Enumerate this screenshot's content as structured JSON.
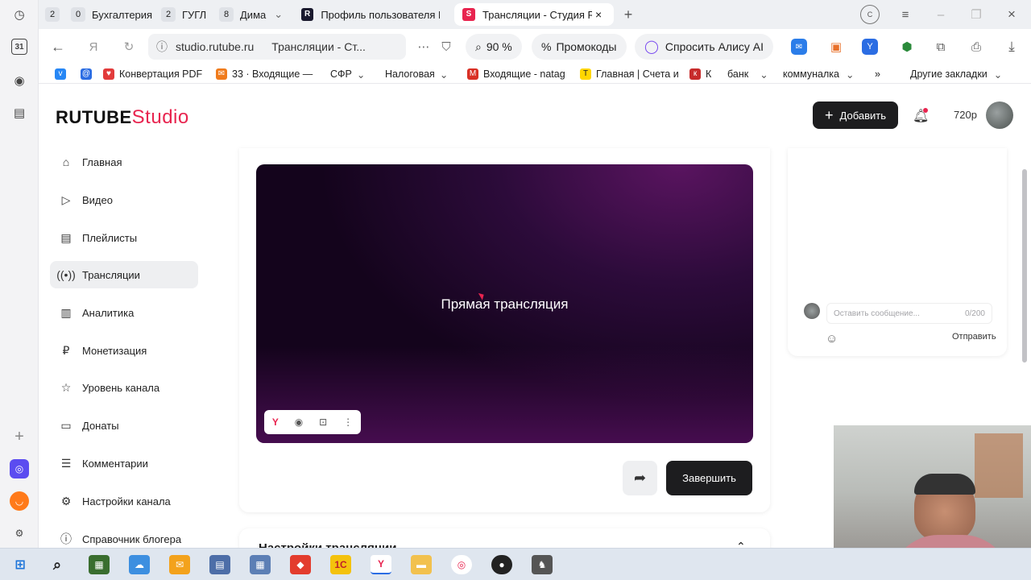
{
  "browser": {
    "tab_groups": [
      {
        "count": "2",
        "label": ""
      },
      {
        "count": "0",
        "label": "Бухгалтерия"
      },
      {
        "count": "2",
        "label": "ГУГЛ"
      },
      {
        "count": "8",
        "label": "Дима"
      }
    ],
    "tabs": [
      {
        "label": "Профиль пользователя Р",
        "active": false
      },
      {
        "label": "Трансляции - Студия R",
        "active": true
      }
    ],
    "address": {
      "domain": "studio.rutube.ru",
      "page_title": "Трансляции - Ст..."
    },
    "zoom": "90 %",
    "promo_label": "Промокоды",
    "alice_label": "Спросить Алису AI",
    "bookmarks": [
      "Конвертация PDF",
      "33 · Входящие — ",
      "СФР",
      "Налоговая",
      "Входящие - natag",
      "Главная | Счета и",
      "К",
      "банк",
      "коммуналка"
    ],
    "other_bookmarks": "Другие закладки",
    "side_calendar": "31"
  },
  "header": {
    "logo_main": "RUTUBE",
    "logo_studio": "Studio",
    "add_label": "Добавить",
    "quality": "720p"
  },
  "nav": [
    {
      "label": "Главная",
      "icon": "home-icon"
    },
    {
      "label": "Видео",
      "icon": "video-icon"
    },
    {
      "label": "Плейлисты",
      "icon": "playlist-icon"
    },
    {
      "label": "Трансляции",
      "icon": "broadcast-icon",
      "active": true
    },
    {
      "label": "Аналитика",
      "icon": "analytics-icon"
    },
    {
      "label": "Монетизация",
      "icon": "ruble-icon"
    },
    {
      "label": "Уровень канала",
      "icon": "star-icon"
    },
    {
      "label": "Донаты",
      "icon": "wallet-icon"
    },
    {
      "label": "Комментарии",
      "icon": "comment-icon"
    },
    {
      "label": "Настройки канала",
      "icon": "gear-icon"
    },
    {
      "label": "Справочник блогера",
      "icon": "help-icon"
    }
  ],
  "player": {
    "title": "Прямая трансляция"
  },
  "actions": {
    "finish_label": "Завершить"
  },
  "settings_title": "Настройки трансляции",
  "chat": {
    "placeholder": "Оставить сообщение...",
    "counter": "0/200",
    "send_label": "Отправить"
  },
  "taskbar": {
    "apps": [
      "start",
      "search",
      "archive",
      "cloud",
      "mail",
      "docs",
      "calculator",
      "anydesk",
      "1c",
      "yandex",
      "explorer",
      "chrome",
      "obs",
      "game"
    ]
  },
  "colors": {
    "accent": "#e8244f",
    "dark_button": "#1d1d1f"
  }
}
